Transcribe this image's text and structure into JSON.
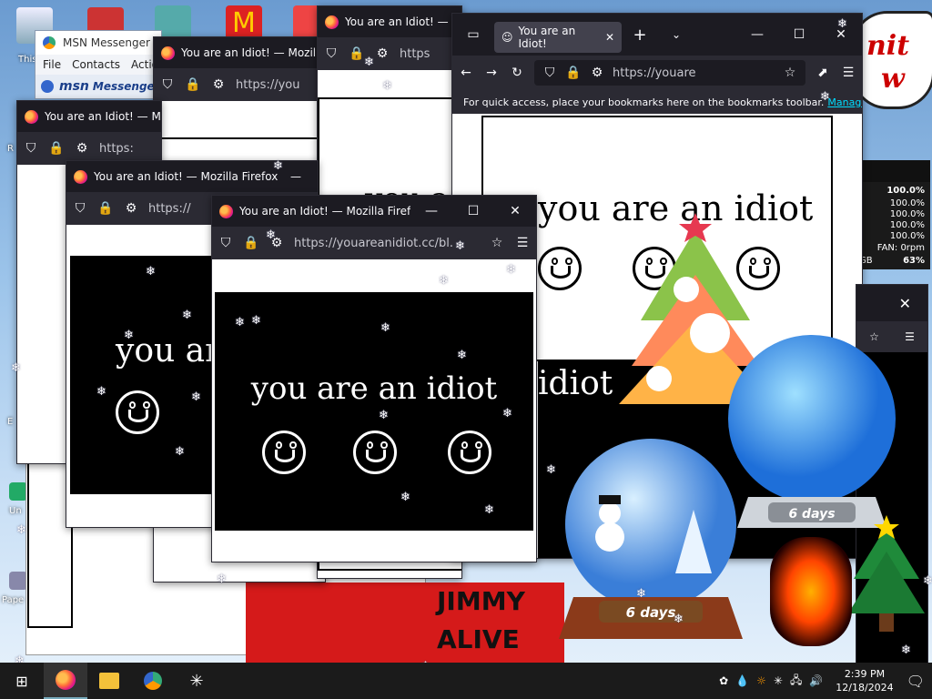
{
  "desktop": {
    "icons": [
      {
        "name": "this-pc-icon",
        "label": "This"
      },
      {
        "name": "recycle-icon",
        "label": "R"
      },
      {
        "name": "edge-icon",
        "label": "E"
      },
      {
        "name": "uninstall-icon",
        "label": "Un"
      },
      {
        "name": "paper-icon",
        "label": "Pape"
      }
    ]
  },
  "msn": {
    "title": "MSN Messenger",
    "menu": [
      "File",
      "Contacts",
      "Actio"
    ],
    "brand": "msn",
    "brand2": "Messenge"
  },
  "windows": {
    "w1": {
      "title": "You are an Idiot! — Mozilla F",
      "url": "https://you"
    },
    "w2": {
      "title": "You are an Idiot! — Mo",
      "url": "https:"
    },
    "w3": {
      "title": "You are an Idiot! — Mo",
      "url": "https",
      "text": "you a"
    },
    "w4": {
      "title": "You are an Idiot! — Mozilla Firefox",
      "url": "https://",
      "text": "you are"
    },
    "w5": {
      "title": "You are an Idiot! — Mozilla Firefox",
      "url": "https://youareanidiot.cc/bl.",
      "text": "you are an idiot"
    },
    "w6": {
      "tab": "You are an Idiot!",
      "url": "https://youare",
      "bookmarks": "For quick access, place your bookmarks here on the bookmarks toolbar.",
      "manage": "Manage bo",
      "text": "you are an idiot",
      "text2": "idiot"
    }
  },
  "perf": {
    "values": [
      "100.0%",
      "100.0%",
      "100.0%",
      "100.0%",
      "100.0%"
    ],
    "fan": "FAN: 0rpm",
    "gb": "GB",
    "gbval": "63%"
  },
  "speech": {
    "l1": "nit",
    "l2": "w"
  },
  "banner": {
    "l1": "JIMMY",
    "l2": "ALIVE"
  },
  "globes": {
    "g1": "6 days",
    "g2": "6 days"
  },
  "taskbar": {
    "time": "2:39 PM",
    "date": "12/18/2024"
  }
}
